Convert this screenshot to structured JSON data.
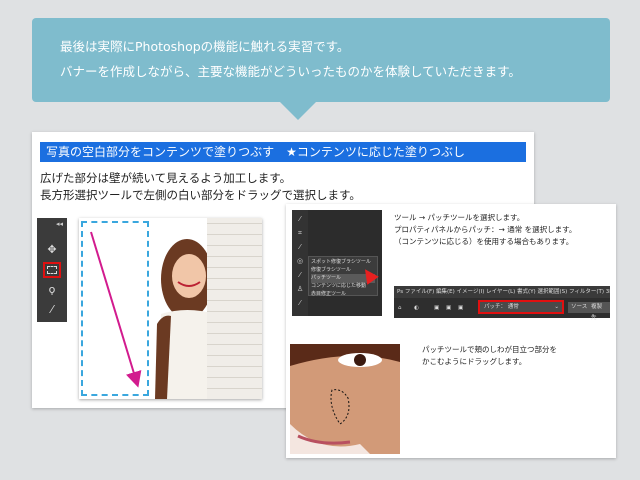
{
  "intro": {
    "line1": "最後は実際にPhotoshopの機能に触れる実習です。",
    "line2": "バナーを作成しながら、主要な機能がどういったものかを体験していただきます。"
  },
  "slide1": {
    "heading": "写真の空白部分をコンテンツで塗りつぶす　★コンテンツに応じた塗りつぶし",
    "desc1": "広げた部分は壁が続いて見えるよう加工します。",
    "desc2": "長方形選択ツールで左側の白い部分をドラッグで選択します。"
  },
  "slide2": {
    "note1_line1": "ツール → パッチツールを選択します。",
    "note1_line2": "プロパティパネルからパッチ：→ 通常 を選択します。",
    "note1_line3": "（コンテンツに応じる）を使用する場合もあります。",
    "flyout": [
      "スポット修復ブラシツール",
      "修復ブラシツール",
      "パッチツール",
      "コンテンツに応じた移動",
      "赤目修正ツール"
    ],
    "menubar": "Ps  ファイル(F)  編集(E)  イメージ(I)  レイヤー(L)  書式(Y)  選択範囲(S)  フィルター(T)  3D(D)  表示(V)",
    "patch_label": "パッチ：",
    "patch_value": "通常",
    "source_btn": "ソース",
    "dest_btn": "複製先",
    "note2_line1": "パッチツールで頬のしわが目立つ部分を",
    "note2_line2": "かこむようにドラッグします。"
  },
  "colors": {
    "bubble": "#7fbccd",
    "heading_bar": "#1b6fe0",
    "highlight": "#e01010",
    "selection": "#3aa7de",
    "arrow": "#d21b8e"
  }
}
